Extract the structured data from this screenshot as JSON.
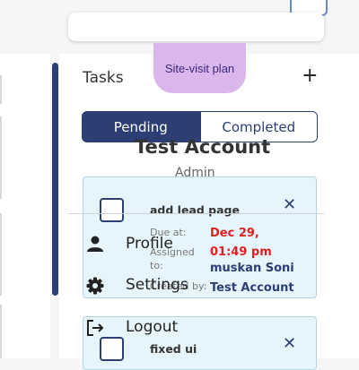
{
  "tasks_panel": {
    "title": "Tasks",
    "add_label": "+",
    "sticky_note": "Site-visit plan",
    "tabs": [
      {
        "label": "Pending",
        "active": true
      },
      {
        "label": "Completed",
        "active": false
      }
    ],
    "cards": [
      {
        "name": "add lead page",
        "close_label": "✕",
        "due_label": "Due at:",
        "due_value": "Dec 29, 01:49 pm",
        "assigned_label": "Assigned to:",
        "assigned_value": "muskan Soni",
        "created_label": "Created by:",
        "created_value": "Test Account"
      },
      {
        "name": "fixed ui",
        "close_label": "✕"
      }
    ]
  },
  "profile_menu": {
    "account_name": "Test Account",
    "account_role": "Admin",
    "items": [
      {
        "label": "Profile",
        "icon": "person-icon"
      },
      {
        "label": "Settings",
        "icon": "gear-icon"
      },
      {
        "label": "Logout",
        "icon": "logout-icon"
      }
    ]
  },
  "colors": {
    "primary": "#2c3e74",
    "card_bg": "#e6f5fb",
    "due_red": "#e02020",
    "sticky_note": "#d9b7ec"
  }
}
